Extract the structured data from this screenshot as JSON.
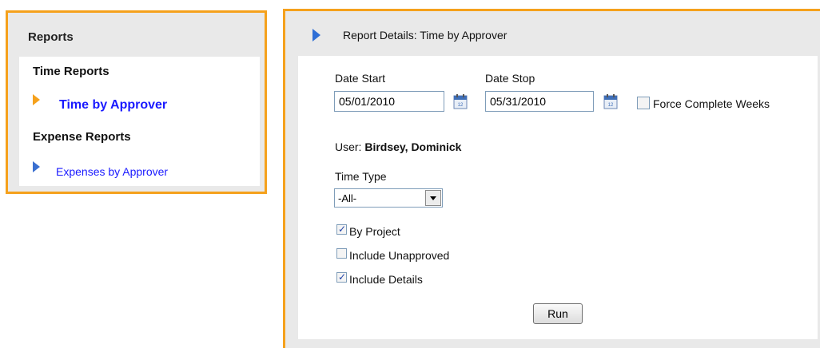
{
  "reports_panel": {
    "title": "Reports",
    "sections": [
      {
        "heading": "Time Reports",
        "items": [
          {
            "label": "Time by Approver",
            "selected": true
          }
        ]
      },
      {
        "heading": "Expense Reports",
        "items": [
          {
            "label": "Expenses by Approver",
            "selected": false
          }
        ]
      }
    ]
  },
  "report_details": {
    "title": "Report Details: Time by Approver",
    "date_start": {
      "label": "Date Start",
      "value": "05/01/2010"
    },
    "date_stop": {
      "label": "Date Stop",
      "value": "05/31/2010"
    },
    "force_complete_weeks": {
      "label": "Force Complete Weeks",
      "checked": false
    },
    "user": {
      "label": "User:",
      "value": "Birdsey, Dominick"
    },
    "time_type": {
      "label": "Time Type",
      "selected": "-All-"
    },
    "options": [
      {
        "label": "By Project",
        "checked": true
      },
      {
        "label": "Include Unapproved",
        "checked": false
      },
      {
        "label": "Include Details",
        "checked": true
      }
    ],
    "run_button": "Run"
  },
  "colors": {
    "accent_border": "#f5a11c",
    "panel_bg": "#e9e9e9",
    "link": "#1a1aff",
    "header_arrow": "#2f6fd6"
  },
  "icons": [
    "arrow-right-icon",
    "calendar-icon",
    "dropdown-chevron-icon"
  ]
}
